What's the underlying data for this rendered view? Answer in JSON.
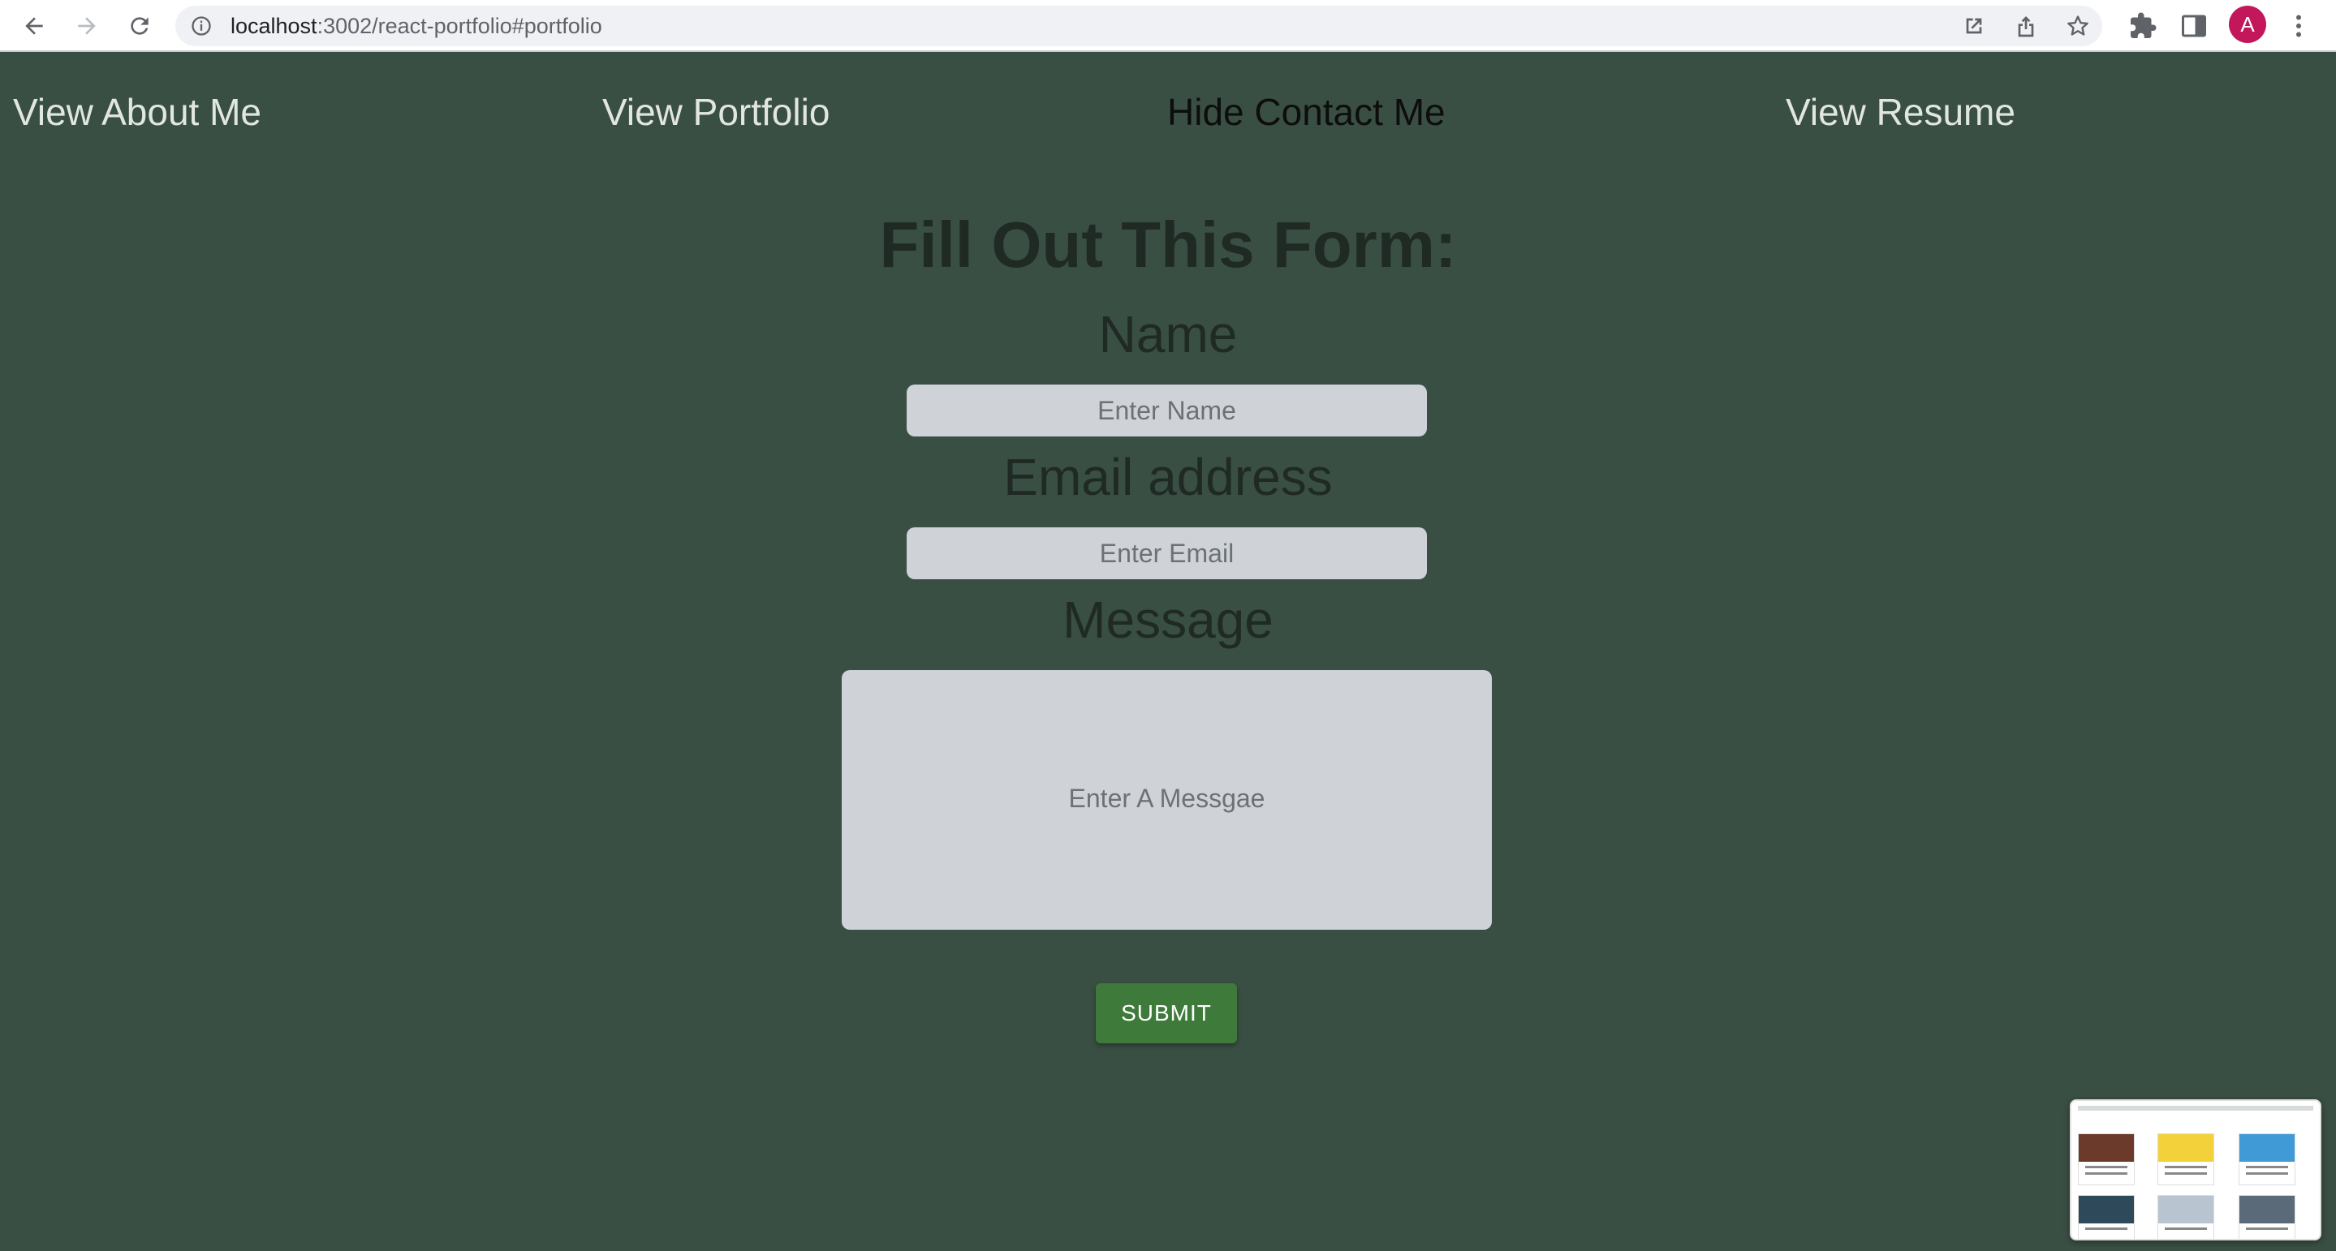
{
  "browser": {
    "url_host": "localhost",
    "url_rest": ":3002/react-portfolio#portfolio",
    "profile_initial": "A",
    "icons": [
      "back-arrow-icon",
      "forward-arrow-icon",
      "reload-icon",
      "info-icon",
      "open-in-new-icon",
      "share-icon",
      "star-icon",
      "puzzle-extension-icon",
      "sidebar-panel-icon",
      "more-vert-icon"
    ]
  },
  "nav": {
    "about": "View About Me",
    "portfolio": "View Portfolio",
    "contact": "Hide Contact Me",
    "resume": "View Resume"
  },
  "form": {
    "title": "Fill Out This Form:",
    "name_label": "Name",
    "name_placeholder": "Enter Name",
    "email_label": "Email address",
    "email_placeholder": "Enter Email",
    "message_label": "Message",
    "message_placeholder": "Enter A Messgae",
    "submit_label": "SUBMIT"
  },
  "colors": {
    "page_background": "#3a4f44",
    "nav_link": "#e2e6e2",
    "nav_link_active": "#0d0d0d",
    "input_background": "#cfd3d8",
    "submit_background": "#3e7a3a",
    "avatar_background": "#c2185b"
  }
}
